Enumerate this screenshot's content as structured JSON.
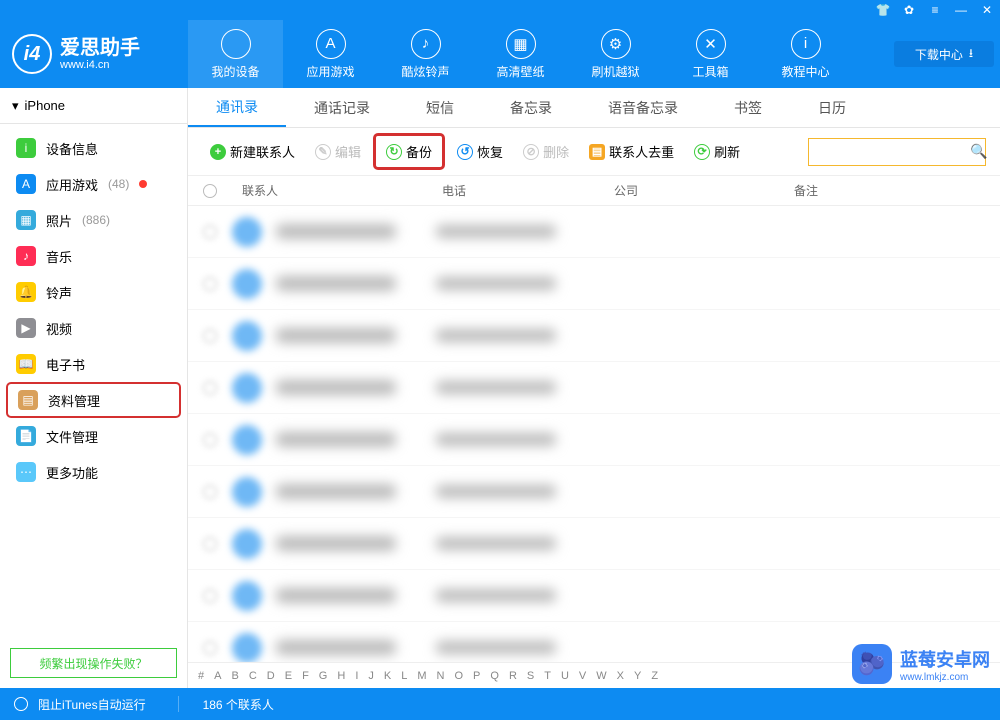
{
  "app": {
    "name_cn": "爱思助手",
    "name_en": "www.i4.cn"
  },
  "download_center": "下载中心",
  "top_nav": [
    {
      "label": "我的设备"
    },
    {
      "label": "应用游戏"
    },
    {
      "label": "酷炫铃声"
    },
    {
      "label": "高清壁纸"
    },
    {
      "label": "刷机越狱"
    },
    {
      "label": "工具箱"
    },
    {
      "label": "教程中心"
    }
  ],
  "device_name": "iPhone",
  "sidebar": [
    {
      "label": "设备信息",
      "color": "#3dcc3d",
      "glyph": "i"
    },
    {
      "label": "应用游戏",
      "count": "(48)",
      "reddot": true,
      "color": "#0d8bf2",
      "glyph": "A"
    },
    {
      "label": "照片",
      "count": "(886)",
      "color": "#34aadc",
      "glyph": "▦"
    },
    {
      "label": "音乐",
      "color": "#ff2d55",
      "glyph": "♪"
    },
    {
      "label": "铃声",
      "color": "#ffcc00",
      "glyph": "🔔"
    },
    {
      "label": "视频",
      "color": "#8e8e93",
      "glyph": "▶"
    },
    {
      "label": "电子书",
      "color": "#ffcc00",
      "glyph": "📖"
    },
    {
      "label": "资料管理",
      "color": "#d9a05b",
      "glyph": "▤",
      "highlight": true
    },
    {
      "label": "文件管理",
      "color": "#34aadc",
      "glyph": "📄"
    },
    {
      "label": "更多功能",
      "color": "#5ac8fa",
      "glyph": "⋯"
    }
  ],
  "faq_text": "频繁出现操作失败？",
  "tabs": [
    {
      "label": "通讯录",
      "active": true
    },
    {
      "label": "通话记录"
    },
    {
      "label": "短信"
    },
    {
      "label": "备忘录"
    },
    {
      "label": "语音备忘录"
    },
    {
      "label": "书签"
    },
    {
      "label": "日历"
    }
  ],
  "toolbar": {
    "new_contact": "新建联系人",
    "edit": "编辑",
    "backup": "备份",
    "restore": "恢复",
    "delete": "删除",
    "dedup": "联系人去重",
    "refresh": "刷新"
  },
  "columns": {
    "contact": "联系人",
    "phone": "电话",
    "company": "公司",
    "remark": "备注"
  },
  "alpha_index": [
    "#",
    "A",
    "B",
    "C",
    "D",
    "E",
    "F",
    "G",
    "H",
    "I",
    "J",
    "K",
    "L",
    "M",
    "N",
    "O",
    "P",
    "Q",
    "R",
    "S",
    "T",
    "U",
    "V",
    "W",
    "X",
    "Y",
    "Z"
  ],
  "footer": {
    "itunes": "阻止iTunes自动运行",
    "contact_count": "186 个联系人"
  },
  "watermark": {
    "cn": "蓝莓安卓网",
    "en": "www.lmkjz.com"
  },
  "row_count": 9
}
